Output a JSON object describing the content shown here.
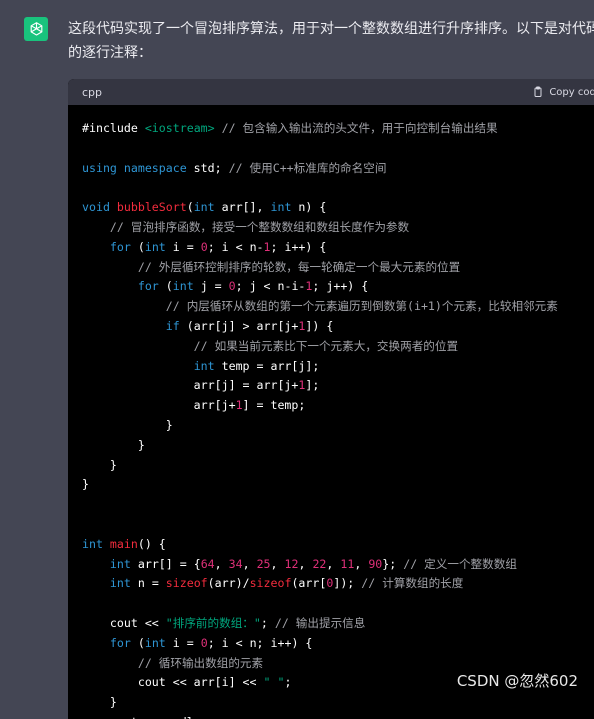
{
  "message": {
    "intro": "这段代码实现了一个冒泡排序算法，用于对一个整数数组进行升序排序。以下是对代码的逐行注释："
  },
  "code_block": {
    "language": "cpp",
    "copy_label": "Copy code",
    "lines": [
      [
        {
          "t": "#include ",
          "c": ""
        },
        {
          "t": "<iostream>",
          "c": "s"
        },
        {
          "t": " // 包含输入输出流的头文件，用于向控制台输出结果",
          "c": "c"
        }
      ],
      [],
      [
        {
          "t": "using namespace",
          "c": "k"
        },
        {
          "t": " std; ",
          "c": ""
        },
        {
          "t": "// 使用C++标准库的命名空间",
          "c": "c"
        }
      ],
      [],
      [
        {
          "t": "void ",
          "c": "k"
        },
        {
          "t": "bubbleSort",
          "c": "f"
        },
        {
          "t": "(",
          "c": ""
        },
        {
          "t": "int",
          "c": "k"
        },
        {
          "t": " arr[], ",
          "c": ""
        },
        {
          "t": "int",
          "c": "k"
        },
        {
          "t": " n) {",
          "c": ""
        }
      ],
      [
        {
          "t": "    // 冒泡排序函数，接受一个整数数组和数组长度作为参数",
          "c": "c"
        }
      ],
      [
        {
          "t": "    ",
          "c": ""
        },
        {
          "t": "for",
          "c": "k"
        },
        {
          "t": " (",
          "c": ""
        },
        {
          "t": "int",
          "c": "k"
        },
        {
          "t": " i = ",
          "c": ""
        },
        {
          "t": "0",
          "c": "n"
        },
        {
          "t": "; i < n-",
          "c": ""
        },
        {
          "t": "1",
          "c": "n"
        },
        {
          "t": "; i++) {",
          "c": ""
        }
      ],
      [
        {
          "t": "        // 外层循环控制排序的轮数，每一轮确定一个最大元素的位置",
          "c": "c"
        }
      ],
      [
        {
          "t": "        ",
          "c": ""
        },
        {
          "t": "for",
          "c": "k"
        },
        {
          "t": " (",
          "c": ""
        },
        {
          "t": "int",
          "c": "k"
        },
        {
          "t": " j = ",
          "c": ""
        },
        {
          "t": "0",
          "c": "n"
        },
        {
          "t": "; j < n-i-",
          "c": ""
        },
        {
          "t": "1",
          "c": "n"
        },
        {
          "t": "; j++) {",
          "c": ""
        }
      ],
      [
        {
          "t": "            // 内层循环从数组的第一个元素遍历到倒数第(i+1)个元素，比较相邻元素",
          "c": "c"
        }
      ],
      [
        {
          "t": "            ",
          "c": ""
        },
        {
          "t": "if",
          "c": "k"
        },
        {
          "t": " (arr[j] > arr[j+",
          "c": ""
        },
        {
          "t": "1",
          "c": "n"
        },
        {
          "t": "]) {",
          "c": ""
        }
      ],
      [
        {
          "t": "                // 如果当前元素比下一个元素大，交换两者的位置",
          "c": "c"
        }
      ],
      [
        {
          "t": "                ",
          "c": ""
        },
        {
          "t": "int",
          "c": "k"
        },
        {
          "t": " temp = arr[j];",
          "c": ""
        }
      ],
      [
        {
          "t": "                arr[j] = arr[j+",
          "c": ""
        },
        {
          "t": "1",
          "c": "n"
        },
        {
          "t": "];",
          "c": ""
        }
      ],
      [
        {
          "t": "                arr[j+",
          "c": ""
        },
        {
          "t": "1",
          "c": "n"
        },
        {
          "t": "] = temp;",
          "c": ""
        }
      ],
      [
        {
          "t": "            }",
          "c": ""
        }
      ],
      [
        {
          "t": "        }",
          "c": ""
        }
      ],
      [
        {
          "t": "    }",
          "c": ""
        }
      ],
      [
        {
          "t": "}",
          "c": ""
        }
      ],
      [],
      [],
      [
        {
          "t": "int ",
          "c": "k"
        },
        {
          "t": "main",
          "c": "f"
        },
        {
          "t": "() {",
          "c": ""
        }
      ],
      [
        {
          "t": "    ",
          "c": ""
        },
        {
          "t": "int",
          "c": "k"
        },
        {
          "t": " arr[] = {",
          "c": ""
        },
        {
          "t": "64",
          "c": "n"
        },
        {
          "t": ", ",
          "c": ""
        },
        {
          "t": "34",
          "c": "n"
        },
        {
          "t": ", ",
          "c": ""
        },
        {
          "t": "25",
          "c": "n"
        },
        {
          "t": ", ",
          "c": ""
        },
        {
          "t": "12",
          "c": "n"
        },
        {
          "t": ", ",
          "c": ""
        },
        {
          "t": "22",
          "c": "n"
        },
        {
          "t": ", ",
          "c": ""
        },
        {
          "t": "11",
          "c": "n"
        },
        {
          "t": ", ",
          "c": ""
        },
        {
          "t": "90",
          "c": "n"
        },
        {
          "t": "}; ",
          "c": ""
        },
        {
          "t": "// 定义一个整数数组",
          "c": "c"
        }
      ],
      [
        {
          "t": "    ",
          "c": ""
        },
        {
          "t": "int",
          "c": "k"
        },
        {
          "t": " n = ",
          "c": ""
        },
        {
          "t": "sizeof",
          "c": "f"
        },
        {
          "t": "(arr)/",
          "c": ""
        },
        {
          "t": "sizeof",
          "c": "f"
        },
        {
          "t": "(arr[",
          "c": ""
        },
        {
          "t": "0",
          "c": "n"
        },
        {
          "t": "]); ",
          "c": ""
        },
        {
          "t": "// 计算数组的长度",
          "c": "c"
        }
      ],
      [],
      [
        {
          "t": "    cout << ",
          "c": ""
        },
        {
          "t": "\"排序前的数组：\"",
          "c": "s"
        },
        {
          "t": "; ",
          "c": ""
        },
        {
          "t": "// 输出提示信息",
          "c": "c"
        }
      ],
      [
        {
          "t": "    ",
          "c": ""
        },
        {
          "t": "for",
          "c": "k"
        },
        {
          "t": " (",
          "c": ""
        },
        {
          "t": "int",
          "c": "k"
        },
        {
          "t": " i = ",
          "c": ""
        },
        {
          "t": "0",
          "c": "n"
        },
        {
          "t": "; i < n; i++) {",
          "c": ""
        }
      ],
      [
        {
          "t": "        // 循环输出数组的元素",
          "c": "c"
        }
      ],
      [
        {
          "t": "        cout << arr[i] << ",
          "c": ""
        },
        {
          "t": "\" \"",
          "c": "s"
        },
        {
          "t": ";",
          "c": ""
        }
      ],
      [
        {
          "t": "    }",
          "c": ""
        }
      ],
      [
        {
          "t": "    cout << endl;",
          "c": ""
        }
      ]
    ]
  },
  "watermark": "CSDN @忽然602",
  "colors": {
    "background": "#444654",
    "code_bg": "#000000",
    "keyword": "#2e95d3",
    "function": "#f22c3d",
    "number": "#df3079",
    "string": "#00a67d",
    "comment": "#a0a1a7",
    "avatar": "#19c37d"
  }
}
